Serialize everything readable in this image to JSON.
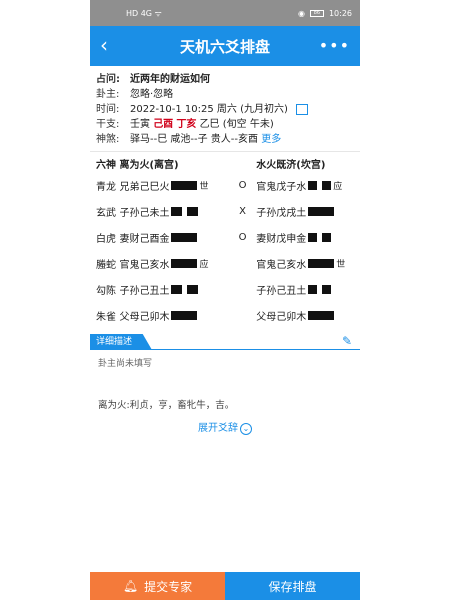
{
  "status": {
    "left": "HD 4G ᯤ",
    "time": "10:26",
    "battery": "86"
  },
  "titlebar": {
    "title": "天机六爻排盘",
    "back_icon": "‹",
    "more_icon": "•••"
  },
  "info": {
    "q_label": "占问:",
    "q_value": "近两年的财运如何",
    "g_label": "卦主:",
    "g_value": "忽略·忽略",
    "t_label": "时间:",
    "t_value": "2022-10-1 10:25 周六 (九月初六)",
    "gz_label": "干支:",
    "gz_a": "壬寅",
    "gz_b": "己酉",
    "gz_c": "丁亥",
    "gz_d": "乙巳",
    "gz_e": "(旬空 午未)",
    "ss_label": "神煞:",
    "ss_value": "驿马--巳 咸池--子 贵人--亥酉",
    "ss_more": "更多"
  },
  "hex": {
    "head": {
      "c1": "六神",
      "c2": "离为火(离宫)",
      "c4": "水火既济(坎宫)"
    },
    "rows": [
      {
        "god": "青龙",
        "main": "兄弟己巳火",
        "mark": "世",
        "change": "O",
        "target": "官鬼戊子水",
        "tmark": "应"
      },
      {
        "god": "玄武",
        "main": "子孙己未土",
        "mark": "",
        "change": "X",
        "target": "子孙戊戌土",
        "tmark": ""
      },
      {
        "god": "白虎",
        "main": "妻财己酉金",
        "mark": "",
        "change": "O",
        "target": "妻财戊申金",
        "tmark": ""
      },
      {
        "god": "螣蛇",
        "main": "官鬼己亥水",
        "mark": "应",
        "change": "",
        "target": "官鬼己亥水",
        "tmark": "世"
      },
      {
        "god": "勾陈",
        "main": "子孙己丑土",
        "mark": "",
        "change": "",
        "target": "子孙己丑土",
        "tmark": ""
      },
      {
        "god": "朱雀",
        "main": "父母己卯木",
        "mark": "",
        "change": "",
        "target": "父母己卯木",
        "tmark": ""
      }
    ]
  },
  "detail": {
    "tab": "详细描述",
    "text": "卦主尚未填写",
    "judgement": "离为火:利贞，亨，畜牝牛，吉。",
    "expand": "展开爻辞"
  },
  "bottom": {
    "consult": "提交专家",
    "save": "保存排盘"
  }
}
